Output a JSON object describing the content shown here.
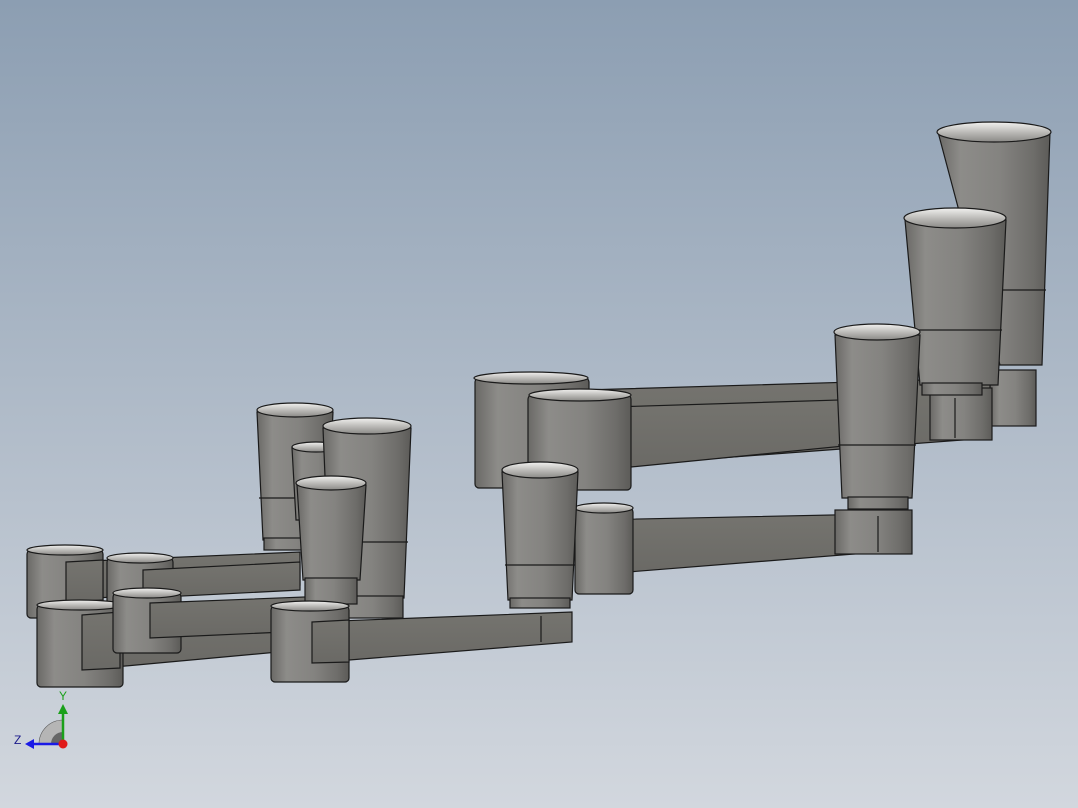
{
  "viewport": {
    "background_top": "#8c9eb2",
    "background_bottom": "#d2d7de",
    "model_body_color": "#7d7c79",
    "model_edge_color": "#1a1a1a"
  },
  "triad": {
    "y_label": "Y",
    "z_label": "Z",
    "y_color": "#1aa01a",
    "z_color": "#1a1ae6",
    "x_color": "#e01a1a",
    "icon": "coordinate-triad-icon"
  }
}
